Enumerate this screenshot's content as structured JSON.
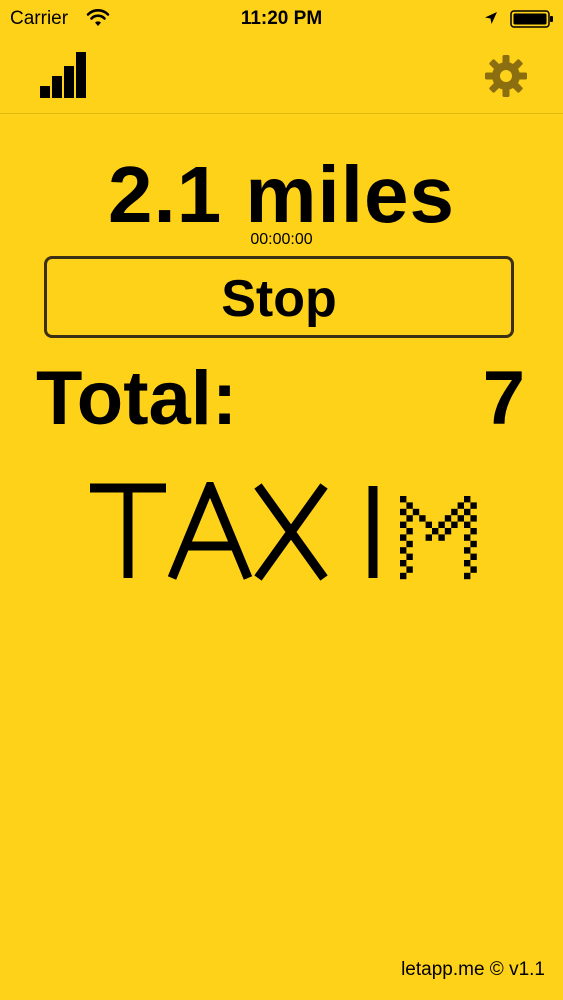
{
  "status_bar": {
    "carrier": "Carrier",
    "time": "11:20 PM",
    "icons": [
      "wifi-icon",
      "location-icon",
      "battery-icon"
    ]
  },
  "toolbar": {
    "left_icon": "stats-icon",
    "right_icon": "gear-icon",
    "gear_color": "#8A6E10"
  },
  "trip": {
    "distance": "2.1 miles",
    "timer": "00:00:00",
    "stop_label": "Stop",
    "total_label": "Total:",
    "total_value": "7"
  },
  "logo": {
    "text": "TAXI",
    "checker_letter": "M"
  },
  "footer": {
    "text": "letapp.me © v1.1"
  },
  "colors": {
    "background": "#FFD21A",
    "text": "#000000",
    "button_border": "#3A3016"
  }
}
